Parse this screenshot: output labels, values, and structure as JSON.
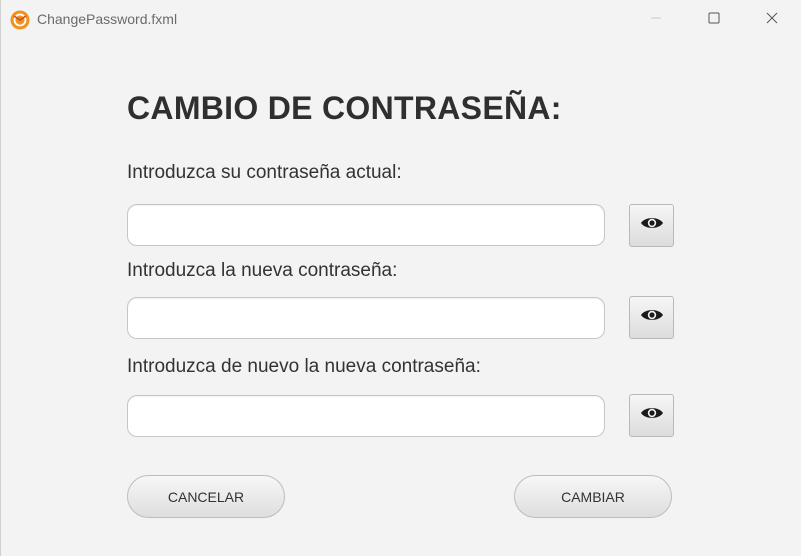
{
  "window": {
    "title": "ChangePassword.fxml",
    "app_icon": "app-logo-icon",
    "controls": {
      "minimize_icon": "minimize-icon",
      "maximize_icon": "maximize-icon",
      "close_icon": "close-icon"
    }
  },
  "form": {
    "heading": "CAMBIO DE CONTRASEÑA:",
    "fields": [
      {
        "label": "Introduzca su contraseña actual:",
        "value": "",
        "toggle_icon": "eye-icon"
      },
      {
        "label": "Introduzca la nueva contraseña:",
        "value": "",
        "toggle_icon": "eye-icon"
      },
      {
        "label": "Introduzca de nuevo la nueva contraseña:",
        "value": "",
        "toggle_icon": "eye-icon"
      }
    ]
  },
  "actions": {
    "cancel_label": "CANCELAR",
    "change_label": "CAMBIAR"
  },
  "colors": {
    "background": "#f3f3f3",
    "heading": "#2f2f2f",
    "app_icon_orange": "#f0921e"
  }
}
